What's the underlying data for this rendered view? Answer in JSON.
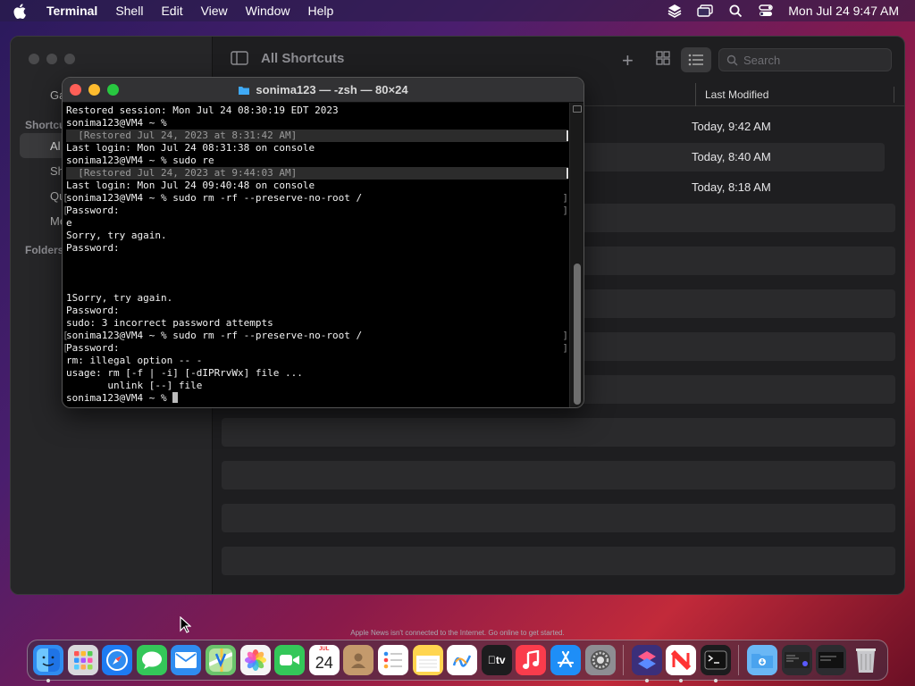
{
  "menubar": {
    "app_name": "Terminal",
    "items": [
      "Shell",
      "Edit",
      "View",
      "Window",
      "Help"
    ],
    "clock": "Mon Jul 24  9:47 AM"
  },
  "shortcuts": {
    "title": "All Shortcuts",
    "search_placeholder": "Search",
    "column_last_modified": "Last Modified",
    "rows": [
      {
        "modified": "Today, 9:42 AM"
      },
      {
        "modified": "Today, 8:40 AM"
      },
      {
        "modified": "Today, 8:18 AM"
      }
    ],
    "sidebar": {
      "items": [
        "Ga",
        "Al",
        "Sh",
        "Qu",
        "Me"
      ],
      "sections": [
        "Shortcu",
        "Folders"
      ]
    }
  },
  "terminal": {
    "title": "sonima123 — -zsh — 80×24",
    "lines": [
      {
        "text": "Restored session: Mon Jul 24 08:30:19 EDT 2023",
        "style": "normal"
      },
      {
        "text": "sonima123@VM4 ~ %",
        "style": "normal"
      },
      {
        "text": "  [Restored Jul 24, 2023 at 8:31:42 AM]",
        "style": "restored"
      },
      {
        "text": "Last login: Mon Jul 24 08:31:38 on console",
        "style": "normal"
      },
      {
        "text": "sonima123@VM4 ~ % sudo re",
        "style": "normal"
      },
      {
        "text": "  [Restored Jul 24, 2023 at 9:44:03 AM]",
        "style": "restored"
      },
      {
        "text": "Last login: Mon Jul 24 09:40:48 on console",
        "style": "normal"
      },
      {
        "text": "sonima123@VM4 ~ % sudo rm -rf --preserve-no-root /",
        "style": "bracket"
      },
      {
        "text": "Password:",
        "style": "bracket"
      },
      {
        "text": "e",
        "style": "normal"
      },
      {
        "text": "Sorry, try again.",
        "style": "normal"
      },
      {
        "text": "Password:",
        "style": "normal"
      },
      {
        "text": "",
        "style": "normal"
      },
      {
        "text": "",
        "style": "normal"
      },
      {
        "text": "",
        "style": "normal"
      },
      {
        "text": "1Sorry, try again.",
        "style": "normal"
      },
      {
        "text": "Password:",
        "style": "normal"
      },
      {
        "text": "sudo: 3 incorrect password attempts",
        "style": "normal"
      },
      {
        "text": "sonima123@VM4 ~ % sudo rm -rf --preserve-no-root /",
        "style": "bracket"
      },
      {
        "text": "Password:",
        "style": "bracket"
      },
      {
        "text": "rm: illegal option -- -",
        "style": "normal"
      },
      {
        "text": "usage: rm [-f | -i] [-dIPRrvWx] file ...",
        "style": "normal"
      },
      {
        "text": "       unlink [--] file",
        "style": "normal"
      }
    ],
    "prompt": "sonima123@VM4 ~ % "
  },
  "dock": {
    "notice": "Apple News isn't connected to the Internet. Go online to get started.",
    "calendar_month": "JUL",
    "calendar_day": "24",
    "apps": [
      {
        "name": "finder-icon",
        "color": "#2f8cf0",
        "running": true
      },
      {
        "name": "launchpad-icon",
        "color": "#d8d8dc",
        "running": false
      },
      {
        "name": "safari-icon",
        "color": "#1d7bf2",
        "running": false
      },
      {
        "name": "messages-icon",
        "color": "#34c759",
        "running": false
      },
      {
        "name": "mail-icon",
        "color": "#2f8cf0",
        "running": false
      },
      {
        "name": "maps-icon",
        "color": "#6ac36b",
        "running": false
      },
      {
        "name": "photos-icon",
        "color": "#f5f5f5",
        "running": false
      },
      {
        "name": "facetime-icon",
        "color": "#34c759",
        "running": false
      },
      {
        "name": "calendar-icon",
        "color": "#ffffff",
        "running": false
      },
      {
        "name": "contacts-icon",
        "color": "#c49a6c",
        "running": false
      },
      {
        "name": "reminders-icon",
        "color": "#ffffff",
        "running": false
      },
      {
        "name": "notes-icon",
        "color": "#ffd54f",
        "running": false
      },
      {
        "name": "freeform-icon",
        "color": "#ffffff",
        "running": false
      },
      {
        "name": "appletv-icon",
        "color": "#1c1c1e",
        "running": false
      },
      {
        "name": "music-icon",
        "color": "#fa3c4c",
        "running": false
      },
      {
        "name": "appstore-icon",
        "color": "#1e8ef7",
        "running": false
      },
      {
        "name": "system-settings-icon",
        "color": "#8e8e93",
        "running": false
      }
    ],
    "tv_label": "tv"
  }
}
